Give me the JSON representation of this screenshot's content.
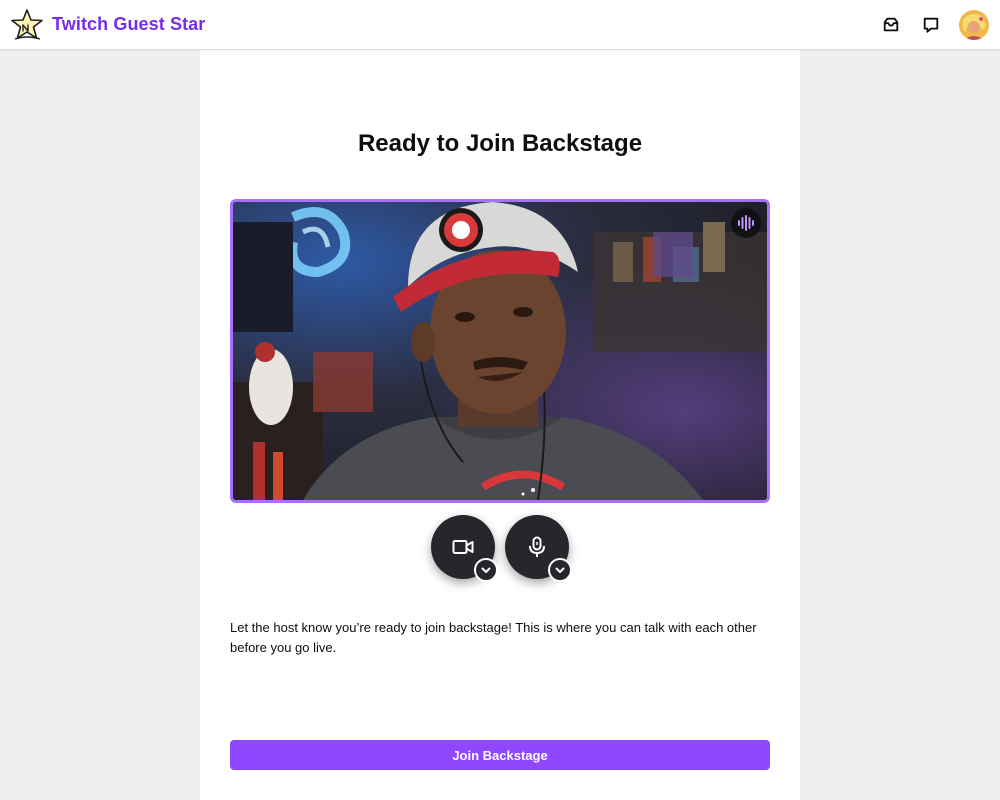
{
  "header": {
    "app_title": "Twitch Guest Star",
    "logo_icon": "star-logo-icon",
    "brand_color": "#772ce8",
    "icons": [
      "inbox-icon",
      "whisper-icon",
      "user-avatar"
    ]
  },
  "main": {
    "title": "Ready to Join Backstage",
    "camera_button_icon": "camera-icon",
    "mic_button_icon": "microphone-icon",
    "audio_indicator_icon": "audio-wave-icon",
    "description": "Let the host know you’re ready to join backstage! This is where you can talk with each other before you go live.",
    "join_button_label": "Join Backstage",
    "accent_color": "#9147ff"
  }
}
